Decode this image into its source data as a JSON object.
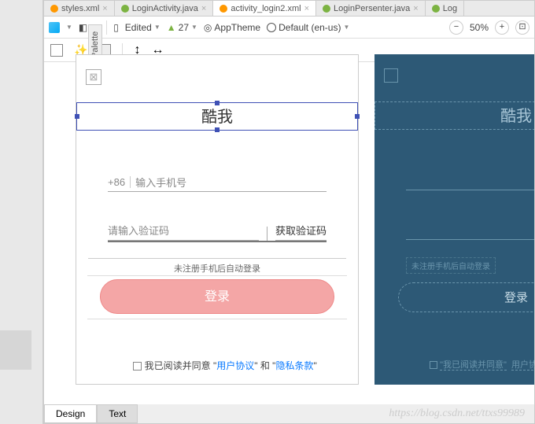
{
  "file_tabs": [
    {
      "name": "styles.xml",
      "type": "xml",
      "active": false
    },
    {
      "name": "LoginActivity.java",
      "type": "java",
      "active": false
    },
    {
      "name": "activity_login2.xml",
      "type": "xml",
      "active": true
    },
    {
      "name": "LoginPersenter.java",
      "type": "java",
      "active": false
    },
    {
      "name": "Log",
      "type": "java",
      "active": false
    }
  ],
  "toolbar": {
    "edited": "Edited",
    "api": "27",
    "theme": "AppTheme",
    "locale": "Default (en-us)",
    "zoom": "50%"
  },
  "app_preview": {
    "title": "酷我",
    "phone_cc": "+86",
    "phone_placeholder": "输入手机号",
    "code_placeholder": "请输入验证码",
    "get_code_label": "获取验证码",
    "hint": "未注册手机后自动登录",
    "login_label": "登录",
    "agree_prefix": "我已阅读并同意 \"",
    "user_proto": "用户协议",
    "agree_mid": "\" 和 \"",
    "privacy": "隐私条款",
    "agree_suffix": "\""
  },
  "blueprint": {
    "title": "酷我",
    "hint": "未注册手机后自动登录",
    "login_label": "登录",
    "agree_text": "我已阅读并同意",
    "user_proto": "用户协"
  },
  "bottom": {
    "design": "Design",
    "text": "Text"
  },
  "watermark": "https://blog.csdn.net/ttxs99989"
}
